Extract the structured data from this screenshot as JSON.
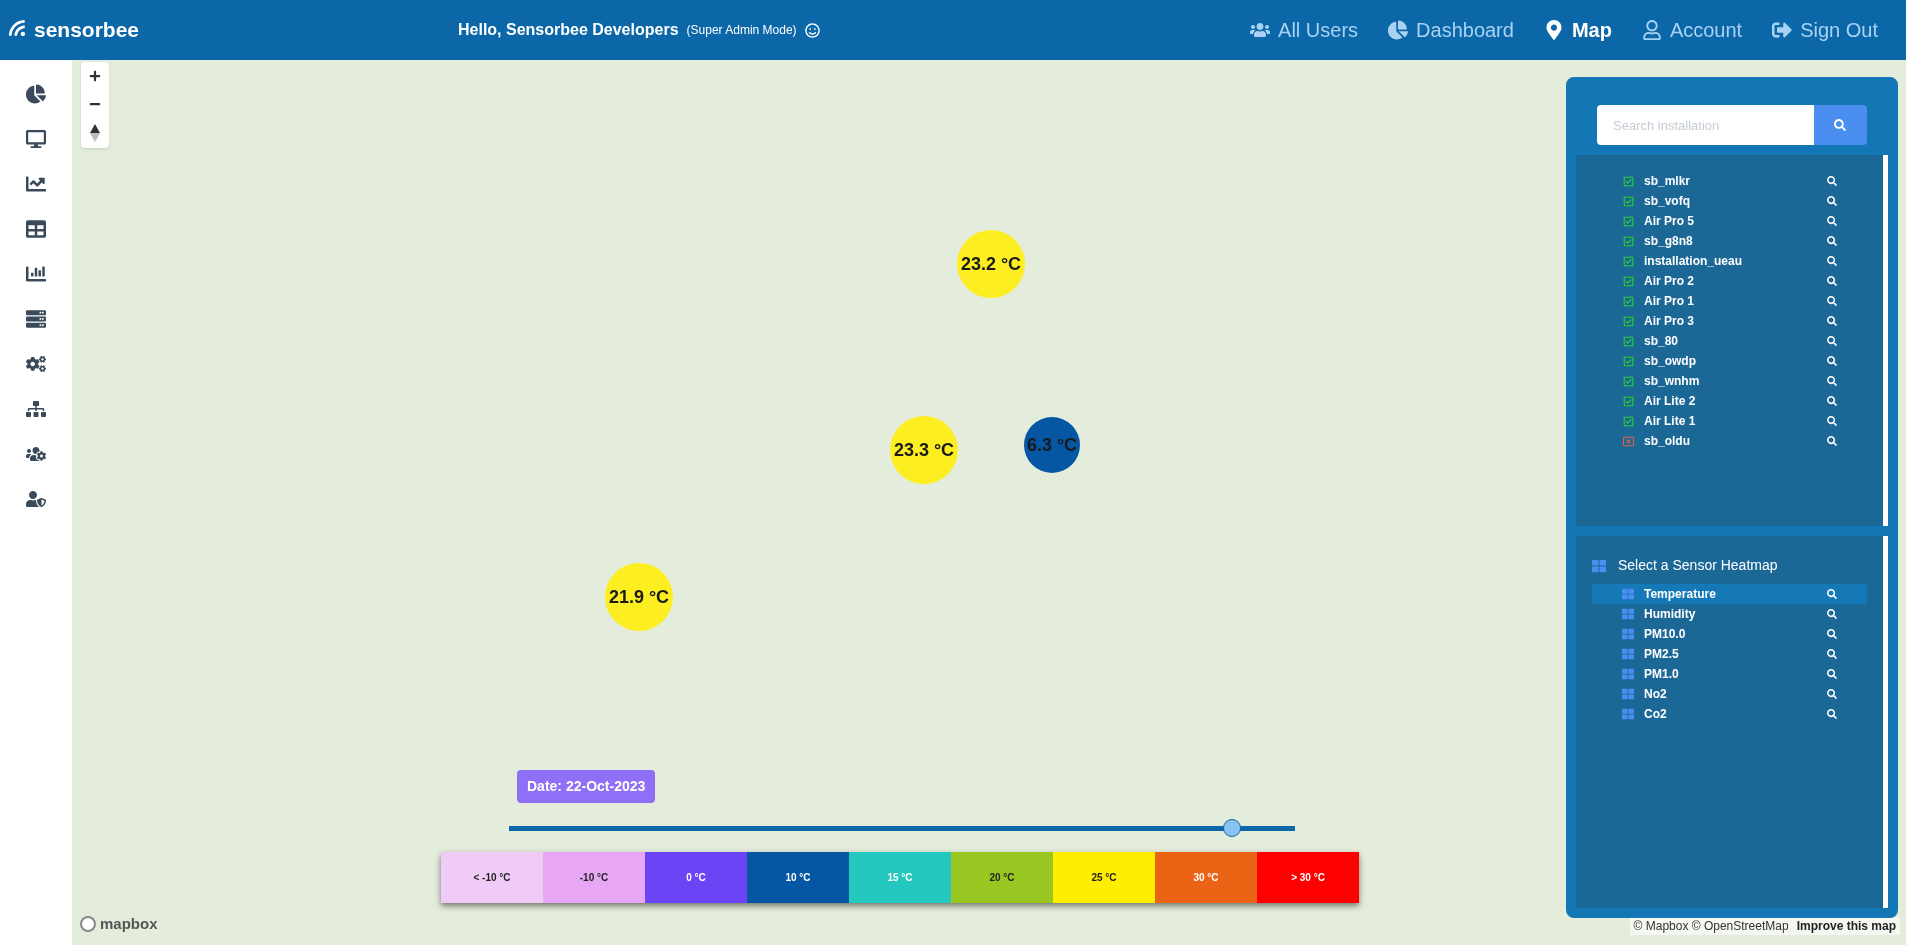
{
  "header": {
    "logo": "sensorbee",
    "greeting": "Hello, Sensorbee Developers",
    "mode": "(Super Admin Mode)",
    "nav": [
      {
        "label": "All Users",
        "selected": false
      },
      {
        "label": "Dashboard",
        "selected": false
      },
      {
        "label": "Map",
        "selected": true
      },
      {
        "label": "Account",
        "selected": false
      },
      {
        "label": "Sign Out",
        "selected": false
      }
    ]
  },
  "map": {
    "markers": [
      {
        "reading": "23.2 °C",
        "color": "#fcee21"
      },
      {
        "reading": "23.3 °C",
        "color": "#fcee21"
      },
      {
        "reading": "6.3 °C",
        "color": "#0557a4"
      },
      {
        "reading": "21.9 °C",
        "color": "#fcee21"
      }
    ],
    "logo": "mapbox",
    "attribution": "© Mapbox © OpenStreetMap",
    "improve_link": "Improve this map"
  },
  "timeline": {
    "date": "Date: 22-Oct-2023",
    "level": 0.92
  },
  "legend": [
    {
      "label": "< -10 °C",
      "color": "#f1cbf7"
    },
    {
      "label": "-10 °C",
      "color": "#e8a7f5"
    },
    {
      "label": "0 °C",
      "color": "#6b45f5"
    },
    {
      "label": "10 °C",
      "color": "#0557a4"
    },
    {
      "label": "15 °C",
      "color": "#24c8bf"
    },
    {
      "label": "20 °C",
      "color": "#99c722"
    },
    {
      "label": "25 °C",
      "color": "#ffee00"
    },
    {
      "label": "30 °C",
      "color": "#eb6314"
    },
    {
      "label": "> 30 °C",
      "color": "#ff0000"
    }
  ],
  "panel": {
    "search": {
      "placeholder": "Search installation"
    },
    "installations": [
      {
        "name": "sb_mlkr",
        "checked": true
      },
      {
        "name": "sb_vofq",
        "checked": true
      },
      {
        "name": "Air Pro 5",
        "checked": true
      },
      {
        "name": "sb_g8n8",
        "checked": true
      },
      {
        "name": "installation_ueau",
        "checked": true
      },
      {
        "name": "Air Pro 2",
        "checked": true
      },
      {
        "name": "Air Pro 1",
        "checked": true
      },
      {
        "name": "Air Pro 3",
        "checked": true
      },
      {
        "name": "sb_80",
        "checked": true
      },
      {
        "name": "sb_owdp",
        "checked": true
      },
      {
        "name": "sb_wnhm",
        "checked": true
      },
      {
        "name": "Air Lite 2",
        "checked": true
      },
      {
        "name": "Air Lite 1",
        "checked": true
      },
      {
        "name": "sb_oldu",
        "checked": false
      }
    ],
    "heatmap_title": "Select a Sensor Heatmap",
    "heatmaps": [
      {
        "name": "Temperature",
        "selected": true
      },
      {
        "name": "Humidity",
        "selected": false
      },
      {
        "name": "PM10.0",
        "selected": false
      },
      {
        "name": "PM2.5",
        "selected": false
      },
      {
        "name": "PM1.0",
        "selected": false
      },
      {
        "name": "No2",
        "selected": false
      },
      {
        "name": "Co2",
        "selected": false
      }
    ]
  }
}
